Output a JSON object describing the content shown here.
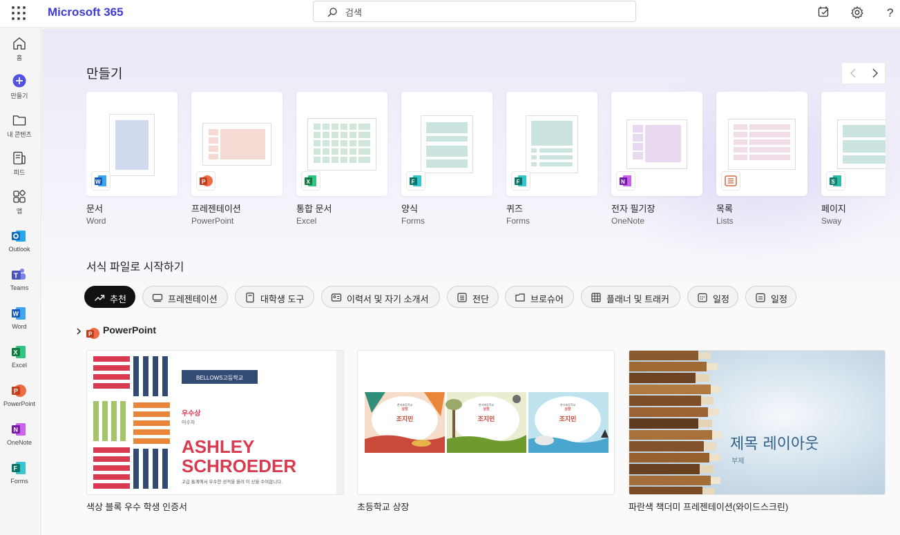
{
  "header": {
    "brand": "Microsoft 365",
    "search_placeholder": "검색"
  },
  "rail": {
    "items": [
      {
        "label": "홈",
        "icon": "home-icon"
      },
      {
        "label": "만들기",
        "icon": "create-plus-icon"
      },
      {
        "label": "내 콘텐츠",
        "icon": "folder-icon"
      },
      {
        "label": "피드",
        "icon": "feed-icon"
      },
      {
        "label": "앱",
        "icon": "apps-icon"
      },
      {
        "label": "Outlook",
        "icon": "outlook-icon"
      },
      {
        "label": "Teams",
        "icon": "teams-icon"
      },
      {
        "label": "Word",
        "icon": "word-icon"
      },
      {
        "label": "Excel",
        "icon": "excel-icon"
      },
      {
        "label": "PowerPoint",
        "icon": "powerpoint-icon"
      },
      {
        "label": "OneNote",
        "icon": "onenote-icon"
      },
      {
        "label": "Forms",
        "icon": "forms-icon"
      }
    ]
  },
  "create": {
    "title": "만들기",
    "cards": [
      {
        "name": "문서",
        "app": "Word",
        "color": "#185abd"
      },
      {
        "name": "프레젠테이션",
        "app": "PowerPoint",
        "color": "#c43e1c"
      },
      {
        "name": "통합 문서",
        "app": "Excel",
        "color": "#107c41"
      },
      {
        "name": "양식",
        "app": "Forms",
        "color": "#077568"
      },
      {
        "name": "퀴즈",
        "app": "Forms",
        "color": "#077568"
      },
      {
        "name": "전자 필기장",
        "app": "OneNote",
        "color": "#7719aa"
      },
      {
        "name": "목록",
        "app": "Lists",
        "color": "#c8501e"
      },
      {
        "name": "페이지",
        "app": "Sway",
        "color": "#108272"
      }
    ]
  },
  "templates": {
    "title": "서식 파일로 시작하기",
    "chips": [
      {
        "label": "추천",
        "icon": "trending-icon",
        "active": true
      },
      {
        "label": "프레젠테이션",
        "icon": "presentation-icon",
        "active": false
      },
      {
        "label": "대학생 도구",
        "icon": "notebook-icon",
        "active": false
      },
      {
        "label": "이력서 및 자기 소개서",
        "icon": "resume-icon",
        "active": false
      },
      {
        "label": "전단",
        "icon": "flyer-icon",
        "active": false
      },
      {
        "label": "브로슈어",
        "icon": "brochure-icon",
        "active": false
      },
      {
        "label": "플래너 및 트래커",
        "icon": "table-icon",
        "active": false
      },
      {
        "label": "일정",
        "icon": "calendar-icon",
        "active": false
      },
      {
        "label": "일정",
        "icon": "calendar-icon",
        "active": false
      }
    ],
    "group_title": "PowerPoint",
    "items": [
      {
        "name": "색상 블록 우수 학생 인증서",
        "school": "BELLOWS고등학교",
        "award": "우수상",
        "award_sub": "미수자",
        "student_line1": "ASHLEY",
        "student_line2": "SCHROEDER",
        "note": "고급 통계에서 우수한 성적을 올려 이 상을 수여합니다."
      },
      {
        "name": "초등학교 상장",
        "school": "한서초등학교",
        "award": "상장",
        "student": "조지민"
      },
      {
        "name": "파란색 책더미 프레젠테이션(와이드스크린)",
        "slide_title": "제목 레이아웃",
        "slide_sub": "부제"
      }
    ]
  }
}
